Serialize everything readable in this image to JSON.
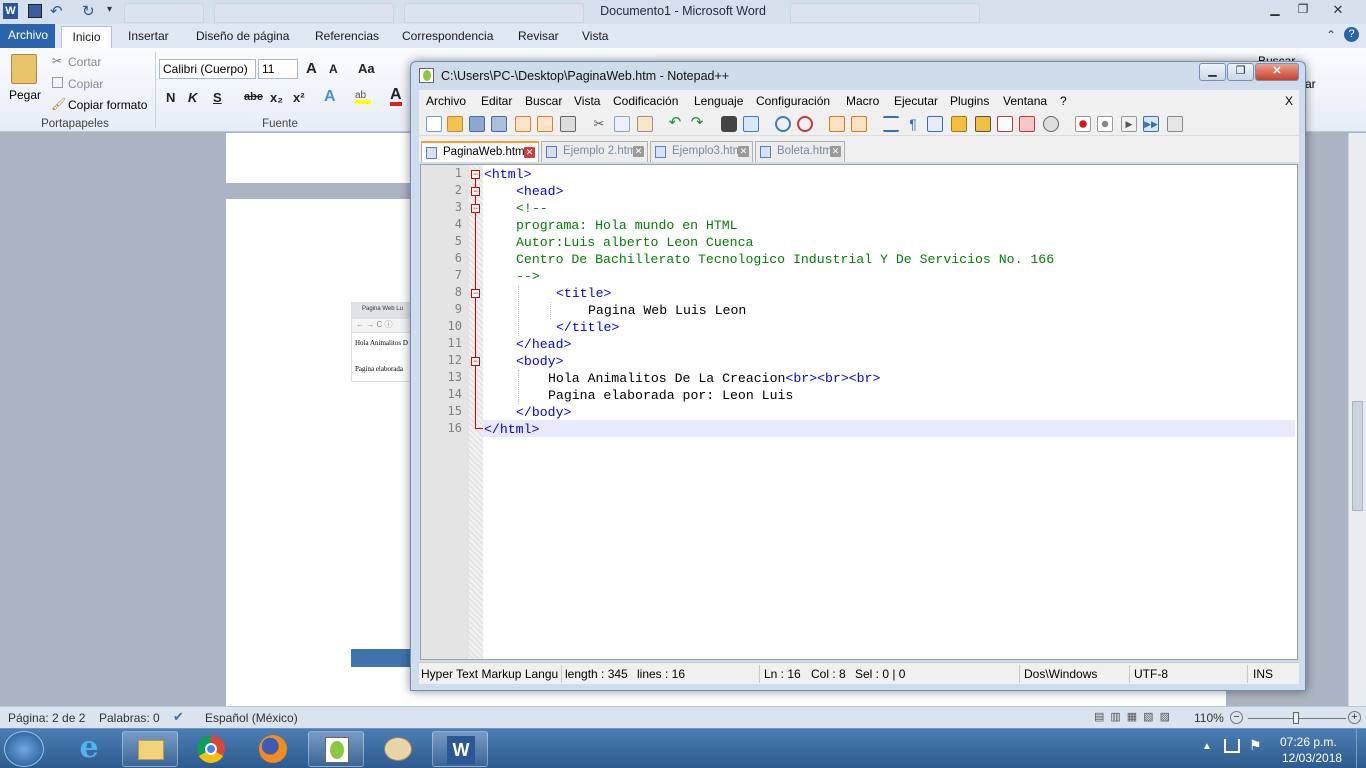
{
  "word": {
    "title": "Documento1  -  Microsoft Word",
    "tabs": [
      "Archivo",
      "Inicio",
      "Insertar",
      "Diseño de página",
      "Referencias",
      "Correspondencia",
      "Revisar",
      "Vista"
    ],
    "clipboard": {
      "paste": "Pegar",
      "cut": "Cortar",
      "copy": "Copiar",
      "format_painter": "Copiar formato",
      "group": "Portapapeles"
    },
    "font": {
      "name": "Calibri (Cuerpo)",
      "size": "11",
      "group": "Fuente",
      "bold": "N",
      "italic": "K",
      "underline": "S",
      "strike": "abe",
      "sub": "x₂",
      "sup": "x²",
      "grow": "A",
      "shrink": "A",
      "case": "Aa"
    },
    "right_ribbon": {
      "find": "Buscar",
      "replace": "ar"
    },
    "thumb": {
      "tab": "Pagina Web Lu",
      "line1": "Hola Animalitos D",
      "line2": "Pagina elaborada"
    },
    "status": {
      "page": "Página: 2 de 2",
      "words": "Palabras: 0",
      "lang": "Español (México)",
      "zoom": "110%"
    }
  },
  "taskbar": {
    "time": "07:26 p.m.",
    "date": "12/03/2018"
  },
  "npp": {
    "title": "C:\\Users\\PC-\\Desktop\\PaginaWeb.htm - Notepad++",
    "menu": [
      "Archivo",
      "Editar",
      "Buscar",
      "Vista",
      "Codificación",
      "Lenguaje",
      "Configuración",
      "Macro",
      "Ejecutar",
      "Plugins",
      "Ventana",
      "?"
    ],
    "menu_close": "X",
    "tabs": [
      "PaginaWeb.htm",
      "Ejemplo 2.htm",
      "Ejemplo3.htm",
      "Boleta.htm"
    ],
    "lines": [
      "1",
      "2",
      "3",
      "4",
      "5",
      "6",
      "7",
      "8",
      "9",
      "10",
      "11",
      "12",
      "13",
      "14",
      "15",
      "16"
    ],
    "code": {
      "l1": "<html>",
      "l2": "<head>",
      "l3": "<!--",
      "l4": "programa: Hola mundo en HTML",
      "l5": "Autor:Luis alberto Leon Cuenca",
      "l6": "Centro De Bachillerato Tecnologico Industrial Y De Servicios No. 166",
      "l7": "-->",
      "l8": "<title>",
      "l9": "Pagina Web Luis Leon",
      "l10": "</title>",
      "l11": "</head>",
      "l12": "<body>",
      "l13a": "Hola Animalitos De La Creacion",
      "l13b": "<br><br><br>",
      "l14": "Pagina elaborada por: Leon Luis",
      "l15": "</body>",
      "l16": "</html>"
    },
    "status": {
      "lang": "Hyper Text Markup Langu",
      "length": "length : 345",
      "lines": "lines : 16",
      "ln": "Ln : 16",
      "col": "Col : 8",
      "sel": "Sel : 0 | 0",
      "eol": "Dos\\Windows",
      "enc": "UTF-8",
      "mode": "INS"
    }
  }
}
